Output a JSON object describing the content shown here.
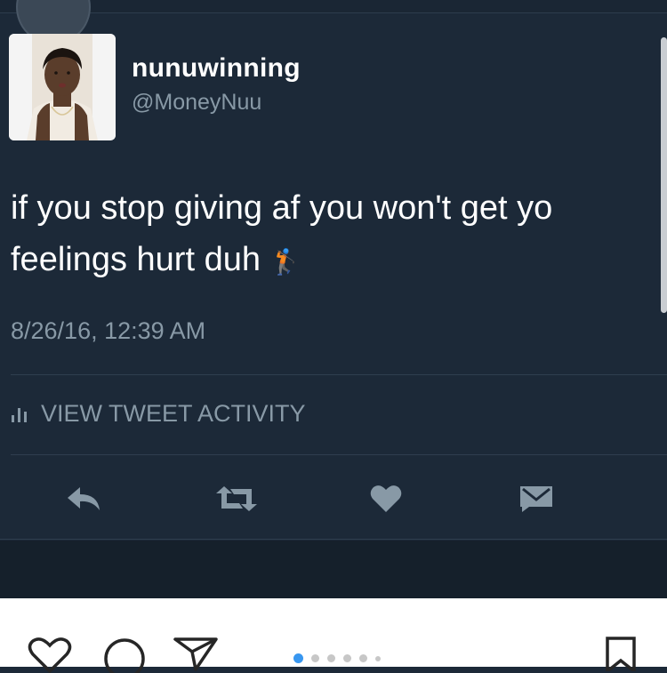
{
  "tweet": {
    "display_name": "nunuwinning",
    "handle": "@MoneyNuu",
    "text": "if you stop giving af you won't get yo feelings hurt duh",
    "emoji": "🏌🏾",
    "timestamp": "8/26/16, 12:39 AM",
    "activity_label": "VIEW TWEET ACTIVITY"
  },
  "actions": [
    {
      "name": "reply",
      "icon": "reply-icon"
    },
    {
      "name": "retweet",
      "icon": "retweet-icon"
    },
    {
      "name": "like",
      "icon": "heart-icon"
    },
    {
      "name": "message",
      "icon": "direct-message-icon"
    }
  ],
  "instagram_bar": {
    "icons": [
      "heart-icon",
      "comment-icon",
      "share-icon",
      "bookmark-icon"
    ],
    "carousel_active_index": 0,
    "carousel_count": 6
  },
  "colors": {
    "background": "#1c2938",
    "text_primary": "#ffffff",
    "text_secondary": "#8899a6",
    "carousel_active": "#3897f0"
  }
}
